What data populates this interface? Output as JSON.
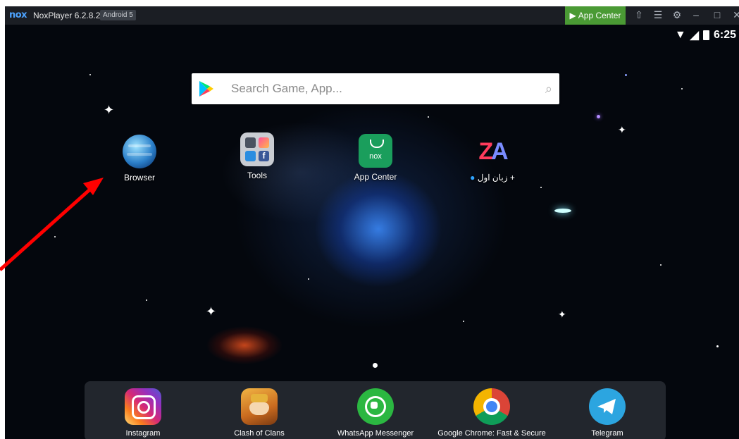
{
  "titlebar": {
    "logo": "nox",
    "title": "NoxPlayer 6.2.8.2",
    "android_badge": "Android 5",
    "app_center_label": "App Center",
    "icons": [
      "shirt-icon",
      "menu-icon",
      "gear-icon",
      "minimize-icon",
      "maximize-icon",
      "close-icon"
    ]
  },
  "statusbar": {
    "time": "6:25",
    "icons": [
      "wifi-icon",
      "signal-icon",
      "battery-icon"
    ]
  },
  "search": {
    "placeholder": "Search Game, App..."
  },
  "desktop_apps": [
    {
      "label": "Browser",
      "icon": "globe-icon"
    },
    {
      "label": "Tools",
      "icon": "tools-folder-icon"
    },
    {
      "label": "App Center",
      "icon": "nox-bag-icon"
    },
    {
      "label": "زبان اول +",
      "icon": "za-logo-icon"
    }
  ],
  "dock_apps": [
    {
      "label": "Instagram",
      "icon": "instagram-icon"
    },
    {
      "label": "Clash of Clans",
      "icon": "clash-of-clans-icon"
    },
    {
      "label": "WhatsApp Messenger",
      "icon": "whatsapp-icon"
    },
    {
      "label": "Google Chrome: Fast & Secure",
      "icon": "chrome-icon"
    },
    {
      "label": "Telegram",
      "icon": "telegram-icon"
    }
  ],
  "colors": {
    "app_center_green": "#4a9a34",
    "arrow_red": "#ff0000",
    "titlebar": "#1b1e24"
  }
}
